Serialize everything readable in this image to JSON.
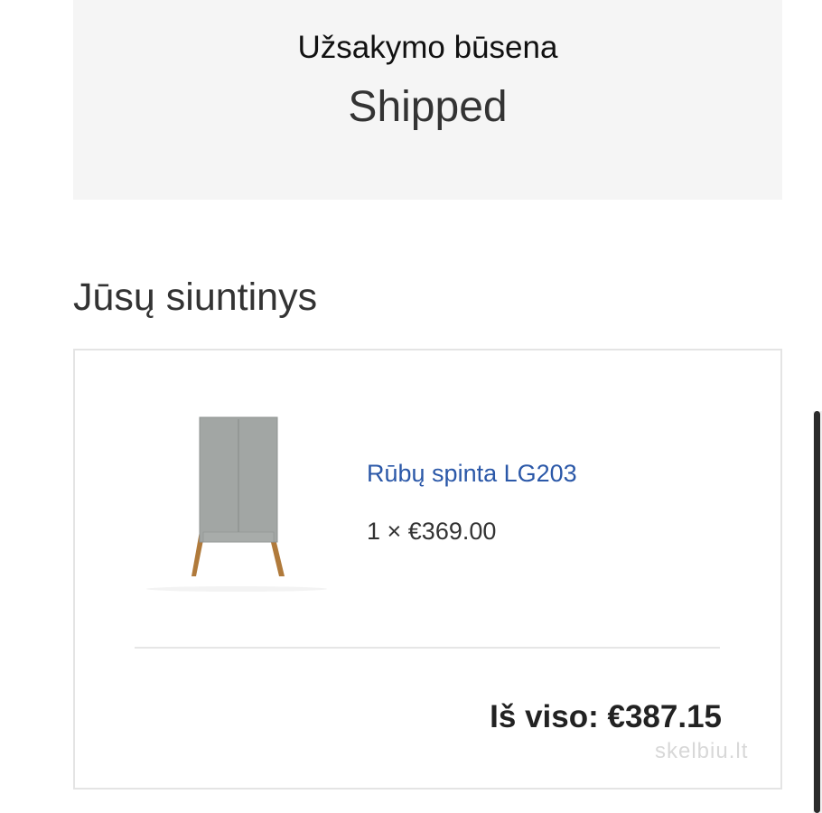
{
  "order_status": {
    "label": "Užsakymo būsena",
    "value": "Shipped"
  },
  "shipment": {
    "heading": "Jūsų siuntinys",
    "items": [
      {
        "name": "Rūbų spinta LG203",
        "quantity_price": "1 × €369.00",
        "image_icon": "wardrobe-product-image"
      }
    ],
    "total": "Iš viso: €387.15"
  },
  "watermark": "skelbiu.lt",
  "colors": {
    "link": "#2b58a8",
    "status_background": "#f5f5f5",
    "card_border": "#e4e4e4"
  }
}
